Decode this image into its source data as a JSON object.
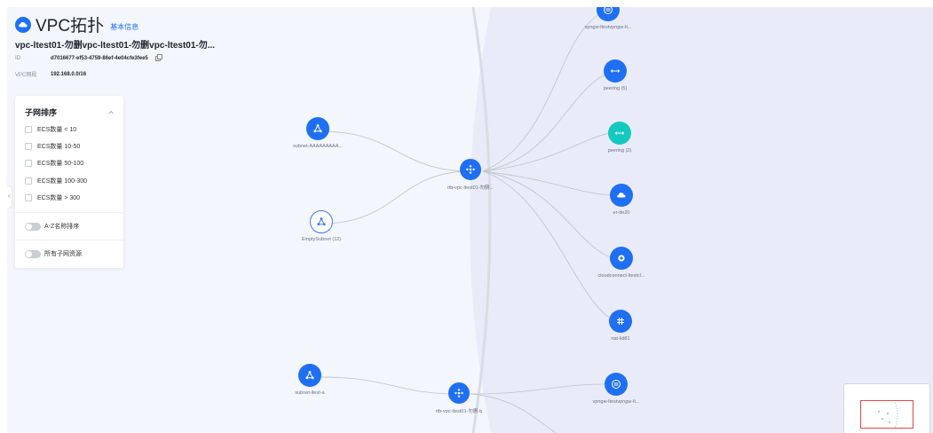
{
  "header": {
    "title": "VPC拓扑",
    "basic_info_link": "基本信息",
    "vpc_name": "vpc-ltest01-勿删vpc-ltest01-勿删vpc-ltest01-勿...",
    "id_label": "ID",
    "id_value": "d7016677-ef53-4759-86ef-4e04cfe3fee5",
    "cidr_label": "VPC网段",
    "cidr_value": "192.168.0.0/16"
  },
  "sort_panel": {
    "title": "子网排序",
    "options": [
      {
        "label": "ECS数量 < 10",
        "checked": false
      },
      {
        "label": "ECS数量 10-50",
        "checked": false
      },
      {
        "label": "ECS数量 50-100",
        "checked": false
      },
      {
        "label": "ECS数量 100-300",
        "checked": false
      },
      {
        "label": "ECS数量 > 300",
        "checked": false
      }
    ],
    "toggle_az": {
      "label": "A-Z名称排序",
      "on": false
    },
    "toggle_all": {
      "label": "所有子网资源",
      "on": false
    },
    "handle_glyph": "<"
  },
  "nodes": {
    "vpngw_top": {
      "label": "vpngw-ltestvpngw-lt...",
      "icon": "vpn-gateway-icon"
    },
    "peering5": {
      "label": "peering (5)",
      "icon": "peering-icon"
    },
    "peering2": {
      "label": "peering (2)",
      "icon": "peering-icon"
    },
    "er": {
      "label": "er-de20",
      "icon": "enterprise-router-icon"
    },
    "cloudconnect": {
      "label": "cloudconnect-ltestcl...",
      "icon": "cloud-connect-icon"
    },
    "nat": {
      "label": "nat-lid81",
      "icon": "nat-gateway-icon"
    },
    "vpngw_bottom": {
      "label": "vpngw-ltestvpngw-lt...",
      "icon": "vpn-gateway-icon"
    },
    "subnet_a_long": {
      "label": "subnet-AAAAAAAAA...",
      "icon": "subnet-icon"
    },
    "empty_subnet": {
      "label": "EmptySubnet (12)",
      "icon": "subnet-icon"
    },
    "rtb1": {
      "label": "rtb-vpc-ltest01-勿删...",
      "icon": "route-table-icon"
    },
    "subnet_ltest_a": {
      "label": "subnet-ltest-a",
      "icon": "subnet-icon"
    },
    "rtb2": {
      "label": "rtb-vpc-ltest01-勿删-b",
      "icon": "route-table-icon"
    }
  },
  "colors": {
    "accent": "#1f6ff2",
    "teal": "#14c9c0",
    "canvas_bg": "#f3f6fc",
    "right_region_bg": "#e9ecf8",
    "edge": "#c4c8cf"
  }
}
